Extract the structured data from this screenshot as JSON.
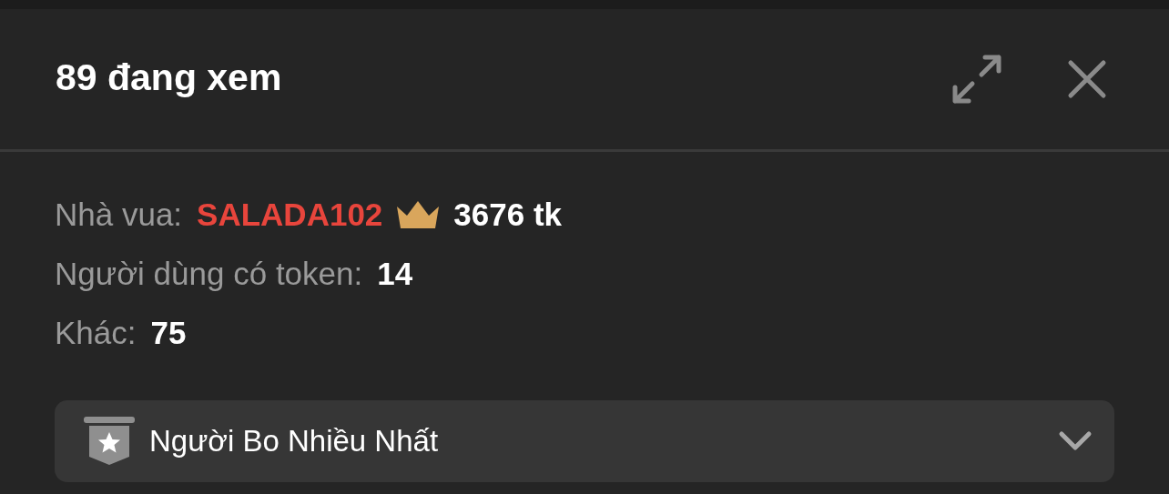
{
  "header": {
    "title": "89 đang xem"
  },
  "king": {
    "label": "Nhà vua:",
    "name": "SALADA102",
    "amount": "3676 tk"
  },
  "stats": [
    {
      "label": "Người dùng có token:",
      "value": "14"
    },
    {
      "label": "Khác:",
      "value": "75"
    }
  ],
  "dropdown": {
    "label": "Người Bo Nhiều Nhất",
    "expanded": false
  }
}
